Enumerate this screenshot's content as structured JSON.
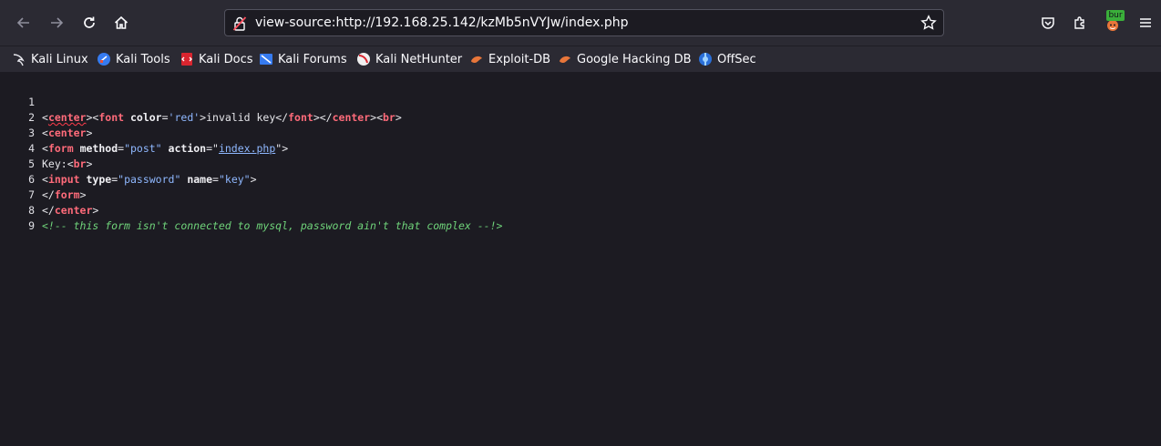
{
  "url": "view-source:http://192.168.25.142/kzMb5nVYJw/index.php",
  "toolbar": {
    "burp_badge": "bur"
  },
  "bookmarks": [
    {
      "label": "Kali Linux",
      "icon": "kali-dragon-icon"
    },
    {
      "label": "Kali Tools",
      "icon": "kali-tools-icon"
    },
    {
      "label": "Kali Docs",
      "icon": "kali-docs-icon"
    },
    {
      "label": "Kali Forums",
      "icon": "kali-forums-icon"
    },
    {
      "label": "Kali NetHunter",
      "icon": "kali-nethunter-icon"
    },
    {
      "label": "Exploit-DB",
      "icon": "exploitdb-icon"
    },
    {
      "label": "Google Hacking DB",
      "icon": "ghdb-icon"
    },
    {
      "label": "OffSec",
      "icon": "offsec-icon"
    }
  ],
  "source": {
    "line_numbers": [
      "1",
      "2",
      "3",
      "4",
      "5",
      "6",
      "7",
      "8",
      "9"
    ],
    "l1": {
      "p1": "<",
      "t1": "center",
      "p2": "><",
      "t2": "font",
      "p3": " ",
      "a1": "color",
      "p4": "=",
      "v1": "'red'",
      "p5": ">invalid key</",
      "t3": "font",
      "p6": "></",
      "t4": "center",
      "p7": "><",
      "t5": "br",
      "p8": ">"
    },
    "l2": {
      "p1": "<",
      "t1": "center",
      "p2": ">"
    },
    "l3": {
      "p1": "<",
      "t1": "form",
      "p2": " ",
      "a1": "method",
      "p3": "=",
      "v1": "\"post\"",
      "p4": " ",
      "a2": "action",
      "p5": "=\"",
      "link": "index.php",
      "p6": "\">"
    },
    "l4": {
      "p1": "Key:<",
      "t1": "br",
      "p2": ">"
    },
    "l5": {
      "p1": "<",
      "t1": "input",
      "p2": " ",
      "a1": "type",
      "p3": "=",
      "v1": "\"password\"",
      "p4": " ",
      "a2": "name",
      "p5": "=",
      "v2": "\"key\"",
      "p6": ">"
    },
    "l6": {
      "p1": "</",
      "t1": "form",
      "p2": ">"
    },
    "l7": {
      "p1": "</",
      "t1": "center",
      "p2": ">"
    },
    "l8": {
      "comment": "<!-- this form isn't connected to mysql, password ain't that complex --!>"
    }
  },
  "colors": {
    "background": "#1c1b22",
    "toolbar": "#2b2a33",
    "tag": "#ff6b7a",
    "value": "#8fb8ff",
    "comment": "#6fd37a"
  }
}
